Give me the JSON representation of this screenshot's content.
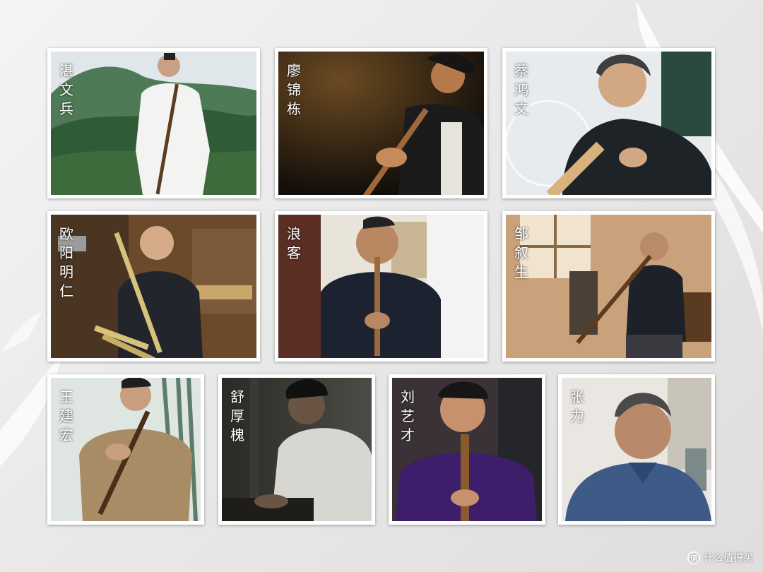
{
  "performers": [
    {
      "name": "湛文兵",
      "icon": "flute-player-photo"
    },
    {
      "name": "廖锦栋",
      "icon": "flute-player-photo"
    },
    {
      "name": "蔡鸿文",
      "icon": "flute-player-photo"
    },
    {
      "name": "欧阳明仁",
      "icon": "flute-player-photo"
    },
    {
      "name": "浪客",
      "icon": "flute-player-photo"
    },
    {
      "name": "邹叙生",
      "icon": "flute-player-photo"
    },
    {
      "name": "王建宏",
      "icon": "flute-player-photo"
    },
    {
      "name": "舒厚槐",
      "icon": "flute-player-photo"
    },
    {
      "name": "刘艺才",
      "icon": "flute-player-photo"
    },
    {
      "name": "张力",
      "icon": "portrait-photo"
    }
  ],
  "watermark": {
    "icon_glyph": "值",
    "text": "什么值得买"
  }
}
